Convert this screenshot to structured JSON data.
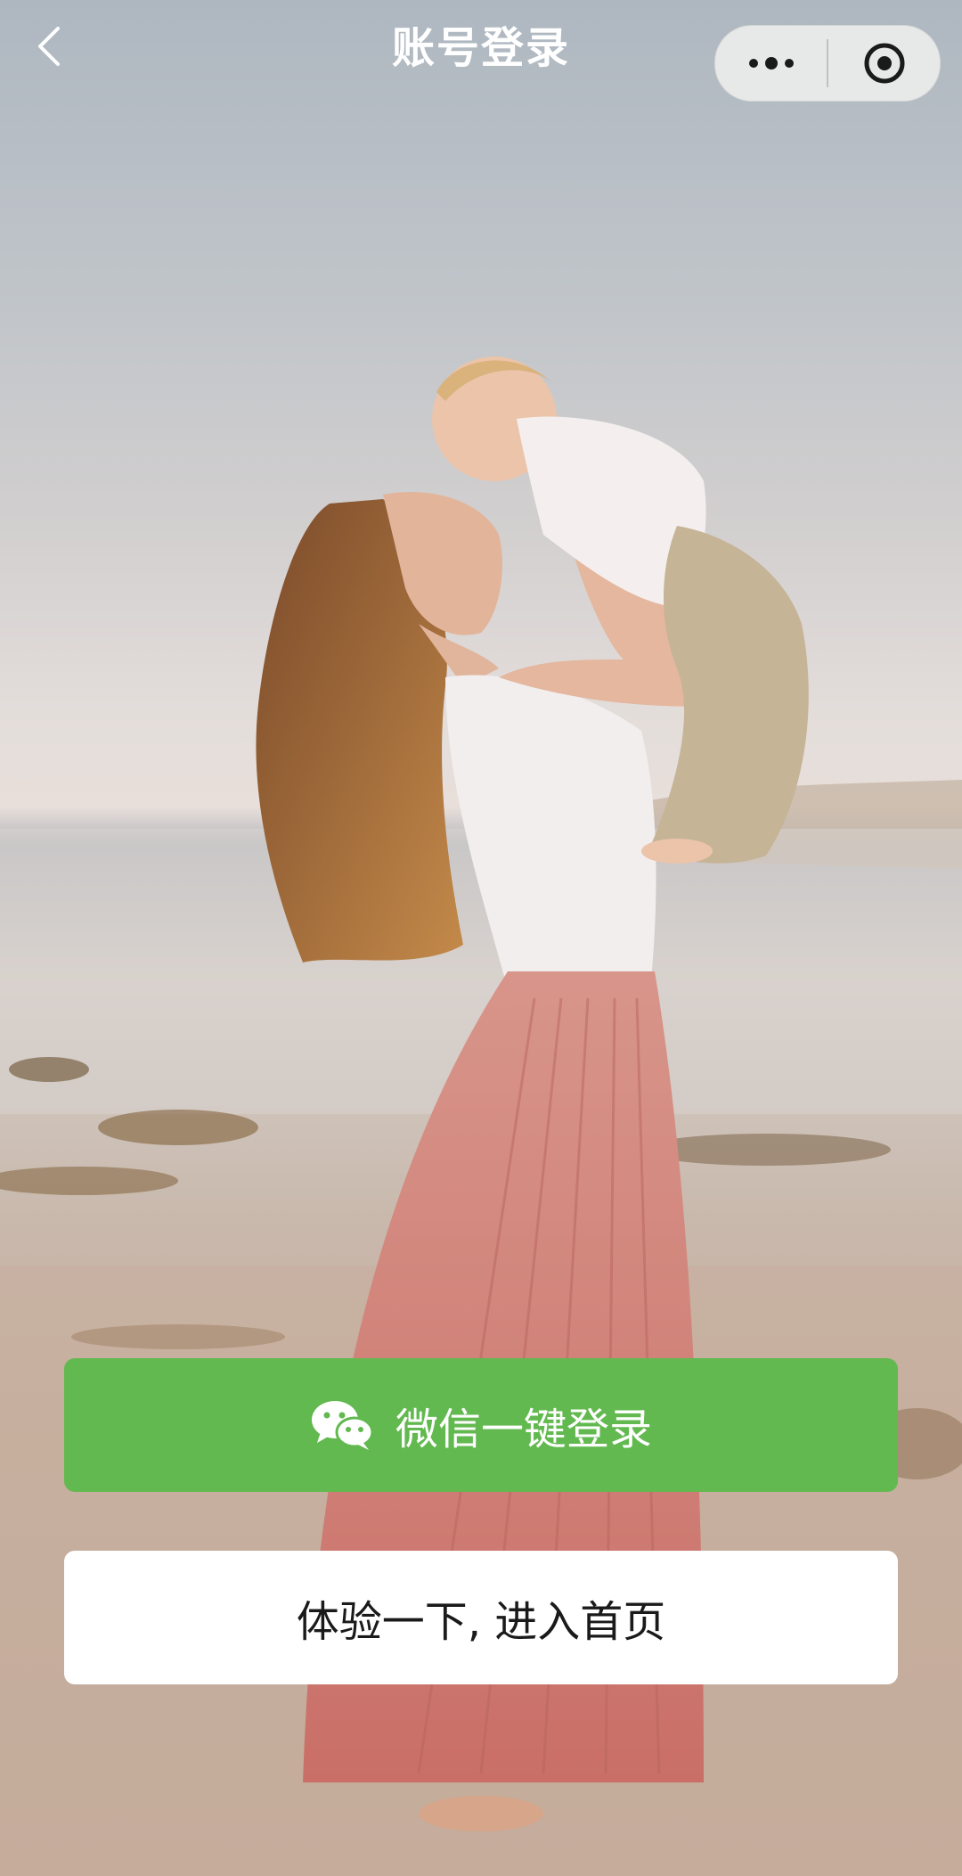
{
  "nav": {
    "title": "账号登录",
    "back_icon": "chevron-left-icon",
    "menu_icon": "more-dots-icon",
    "close_icon": "target-circle-icon"
  },
  "background": {
    "description_icon": "photo-background"
  },
  "actions": {
    "wechat_login_label": "微信一键登录",
    "wechat_icon": "wechat-icon",
    "wechat_color": "#62b94f",
    "guest_label": "体验一下, 进入首页"
  }
}
